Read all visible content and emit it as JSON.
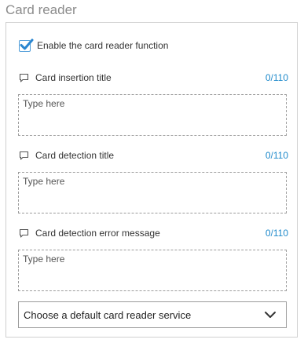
{
  "section": {
    "title": "Card reader"
  },
  "enable_checkbox": {
    "label": "Enable the card reader function",
    "checked": true
  },
  "fields": [
    {
      "label": "Card insertion title",
      "counter": "0/110",
      "placeholder": "Type here",
      "value": "",
      "icon": "comment-icon"
    },
    {
      "label": "Card detection title",
      "counter": "0/110",
      "placeholder": "Type here",
      "value": "",
      "icon": "comment-icon"
    },
    {
      "label": "Card detection error message",
      "counter": "0/110",
      "placeholder": "Type here",
      "value": "",
      "icon": "comment-icon"
    }
  ],
  "service_select": {
    "selected": "Choose a default card reader service",
    "icon": "chevron-down-icon"
  },
  "colors": {
    "accent": "#1f8acb",
    "checkbox_blue": "#4a9ad8",
    "title_gray": "#8c8c8c",
    "border": "#cfcfcf"
  }
}
